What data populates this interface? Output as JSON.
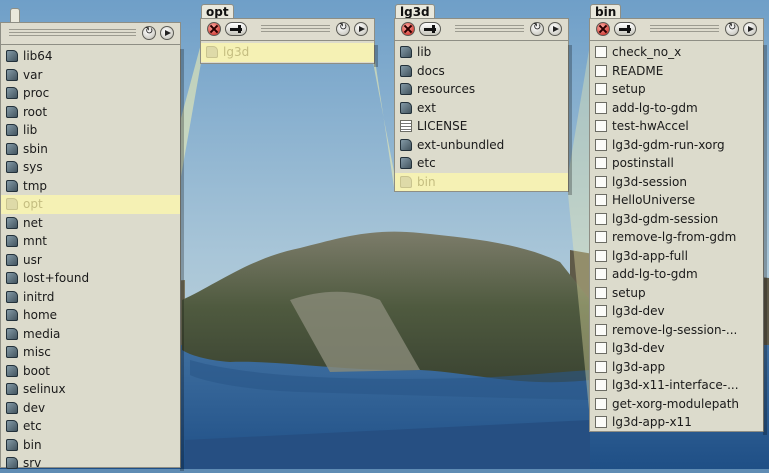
{
  "panels": [
    {
      "tab_label": "",
      "items": [
        {
          "label": "lib64",
          "icon": "folder-icon"
        },
        {
          "label": "var",
          "icon": "folder-icon"
        },
        {
          "label": "proc",
          "icon": "folder-icon"
        },
        {
          "label": "root",
          "icon": "folder-icon"
        },
        {
          "label": "lib",
          "icon": "folder-icon"
        },
        {
          "label": "sbin",
          "icon": "folder-icon"
        },
        {
          "label": "sys",
          "icon": "folder-icon"
        },
        {
          "label": "tmp",
          "icon": "folder-icon"
        },
        {
          "label": "opt",
          "icon": "folder-icon",
          "selected": true
        },
        {
          "label": "net",
          "icon": "folder-icon"
        },
        {
          "label": "mnt",
          "icon": "folder-icon"
        },
        {
          "label": "usr",
          "icon": "folder-icon"
        },
        {
          "label": "lost+found",
          "icon": "folder-icon"
        },
        {
          "label": "initrd",
          "icon": "folder-icon"
        },
        {
          "label": "home",
          "icon": "folder-icon"
        },
        {
          "label": "media",
          "icon": "folder-icon"
        },
        {
          "label": "misc",
          "icon": "folder-icon"
        },
        {
          "label": "boot",
          "icon": "folder-icon"
        },
        {
          "label": "selinux",
          "icon": "folder-icon"
        },
        {
          "label": "dev",
          "icon": "folder-icon"
        },
        {
          "label": "etc",
          "icon": "folder-icon"
        },
        {
          "label": "bin",
          "icon": "folder-icon"
        },
        {
          "label": "srv",
          "icon": "folder-icon"
        }
      ]
    },
    {
      "tab_label": "opt",
      "items": [
        {
          "label": "lg3d",
          "icon": "folder-icon",
          "selected": true
        }
      ]
    },
    {
      "tab_label": "lg3d",
      "items": [
        {
          "label": "lib",
          "icon": "folder-icon"
        },
        {
          "label": "docs",
          "icon": "folder-icon"
        },
        {
          "label": "resources",
          "icon": "folder-icon"
        },
        {
          "label": "ext",
          "icon": "folder-icon"
        },
        {
          "label": "LICENSE",
          "icon": "text-file-icon"
        },
        {
          "label": "ext-unbundled",
          "icon": "folder-icon"
        },
        {
          "label": "etc",
          "icon": "folder-icon"
        },
        {
          "label": "bin",
          "icon": "folder-icon",
          "selected": true
        }
      ]
    },
    {
      "tab_label": "bin",
      "items": [
        {
          "label": "check_no_x",
          "icon": "file-icon"
        },
        {
          "label": "README",
          "icon": "file-icon"
        },
        {
          "label": "setup",
          "icon": "file-icon"
        },
        {
          "label": "add-lg-to-gdm",
          "icon": "file-icon"
        },
        {
          "label": "test-hwAccel",
          "icon": "file-icon"
        },
        {
          "label": "lg3d-gdm-run-xorg",
          "icon": "file-icon"
        },
        {
          "label": "postinstall",
          "icon": "file-icon"
        },
        {
          "label": "lg3d-session",
          "icon": "file-icon"
        },
        {
          "label": "HelloUniverse",
          "icon": "file-icon"
        },
        {
          "label": "lg3d-gdm-session",
          "icon": "file-icon"
        },
        {
          "label": "remove-lg-from-gdm",
          "icon": "file-icon"
        },
        {
          "label": "lg3d-app-full",
          "icon": "file-icon"
        },
        {
          "label": "add-lg-to-gdm",
          "icon": "file-icon"
        },
        {
          "label": "setup",
          "icon": "file-icon"
        },
        {
          "label": "lg3d-dev",
          "icon": "file-icon"
        },
        {
          "label": "remove-lg-session-...",
          "icon": "file-icon"
        },
        {
          "label": "lg3d-dev",
          "icon": "file-icon"
        },
        {
          "label": "lg3d-app",
          "icon": "file-icon"
        },
        {
          "label": "lg3d-x11-interface-...",
          "icon": "file-icon"
        },
        {
          "label": "get-xorg-modulepath",
          "icon": "file-icon"
        },
        {
          "label": "lg3d-app-x11",
          "icon": "file-icon"
        }
      ]
    }
  ]
}
